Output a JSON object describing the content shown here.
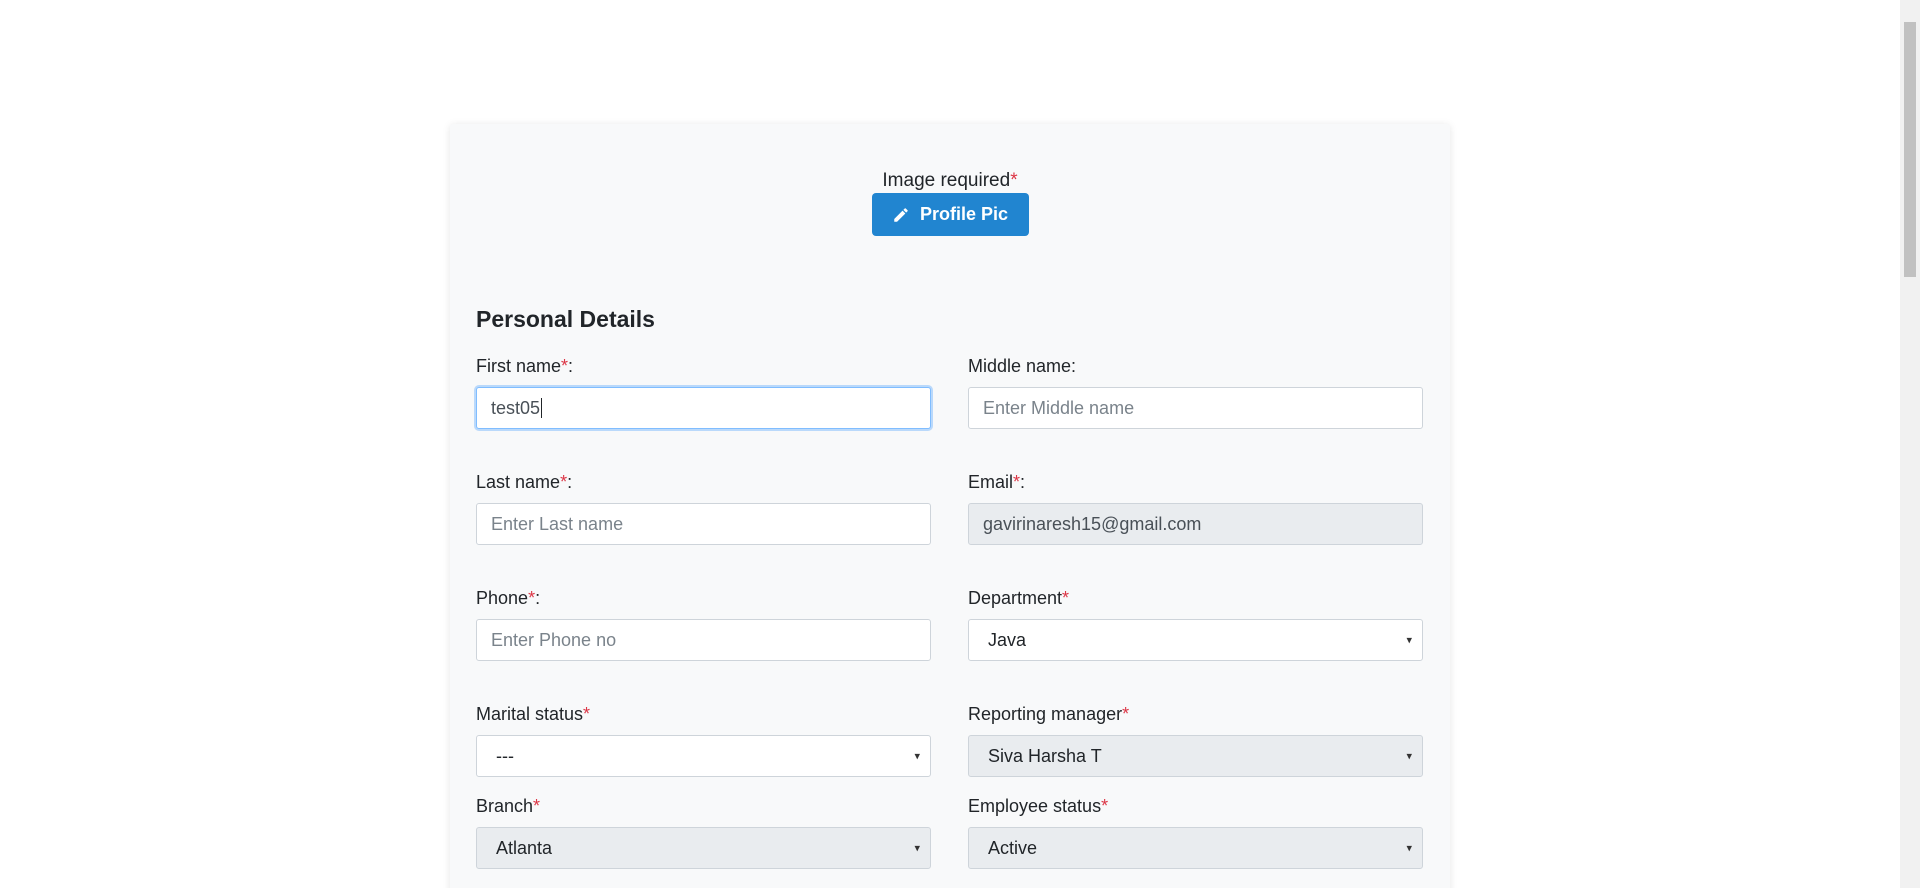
{
  "upload": {
    "label": "Image required",
    "required_mark": "*",
    "button_label": "Profile Pic",
    "button_icon": "pencil-icon"
  },
  "section": {
    "title": "Personal Details"
  },
  "fields": {
    "first_name": {
      "label": "First name",
      "req": "*",
      "suffix": ":",
      "value": "test05"
    },
    "middle_name": {
      "label": "Middle name:",
      "placeholder": "Enter Middle name"
    },
    "last_name": {
      "label": "Last name",
      "req": "*",
      "suffix": ":",
      "placeholder": "Enter Last name"
    },
    "email": {
      "label": "Email",
      "req": "*",
      "suffix": ":",
      "value": "gavirinaresh15@gmail.com"
    },
    "phone": {
      "label": "Phone",
      "req": "*",
      "suffix": ":",
      "placeholder": "Enter Phone no"
    },
    "department": {
      "label": "Department",
      "req": "*",
      "value": "Java"
    },
    "marital_status": {
      "label": "Marital status",
      "req": "*",
      "value": "---"
    },
    "reporting_manager": {
      "label": "Reporting manager",
      "req": "*",
      "value": "Siva Harsha T"
    },
    "branch": {
      "label": "Branch",
      "req": "*",
      "value": "Atlanta"
    },
    "employee_status": {
      "label": "Employee status",
      "req": "*",
      "value": "Active"
    }
  },
  "caret_glyph": "▾",
  "colors": {
    "primary": "#2185d0",
    "required": "#dc3545",
    "focus": "#80bdff"
  }
}
